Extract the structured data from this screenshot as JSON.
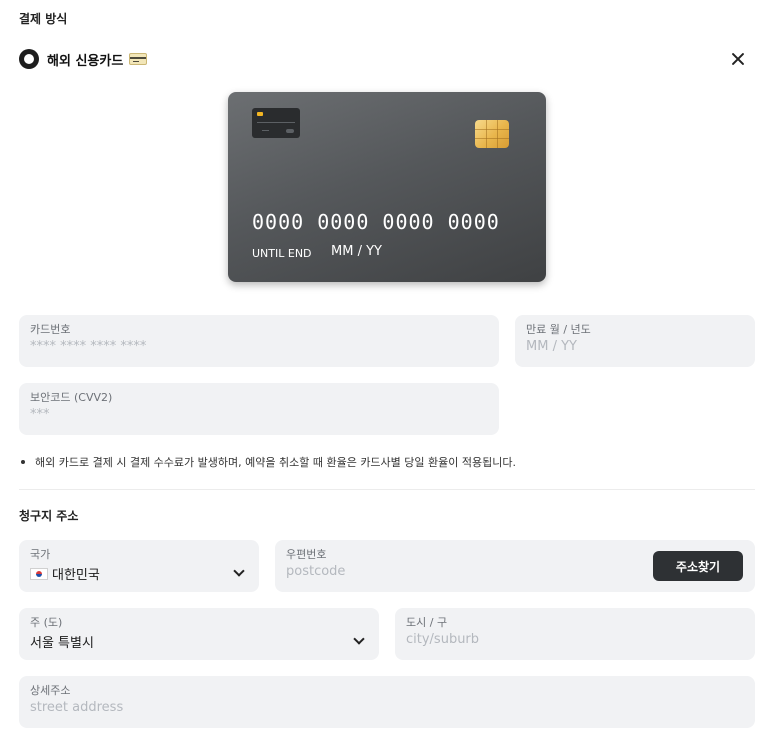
{
  "payment": {
    "section_title": "결제 방식",
    "method_label": "해외 신용카드"
  },
  "card_preview": {
    "number": "0000 0000 0000 0000",
    "until_label": "UNTIL END",
    "expiry": "MM / YY"
  },
  "fields": {
    "card_number": {
      "label": "카드번호",
      "placeholder": "**** **** **** ****"
    },
    "expiry": {
      "label": "만료 월 / 년도",
      "placeholder": "MM / YY"
    },
    "cvv": {
      "label": "보안코드 (CVV2)",
      "placeholder": "***"
    }
  },
  "note": "해외 카드로 결제 시 결제 수수료가 발생하며, 예약을 취소할 때 환율은 카드사별 당일 환율이 적용됩니다.",
  "billing": {
    "section_title": "청구지 주소",
    "country": {
      "label": "국가",
      "value": "대한민국"
    },
    "postcode": {
      "label": "우편번호",
      "placeholder": "postcode"
    },
    "search_button": "주소찾기",
    "state": {
      "label": "주 (도)",
      "value": "서울 특별시"
    },
    "city": {
      "label": "도시 / 구",
      "placeholder": "city/suburb"
    },
    "street": {
      "label": "상세주소",
      "placeholder": "street address"
    }
  }
}
